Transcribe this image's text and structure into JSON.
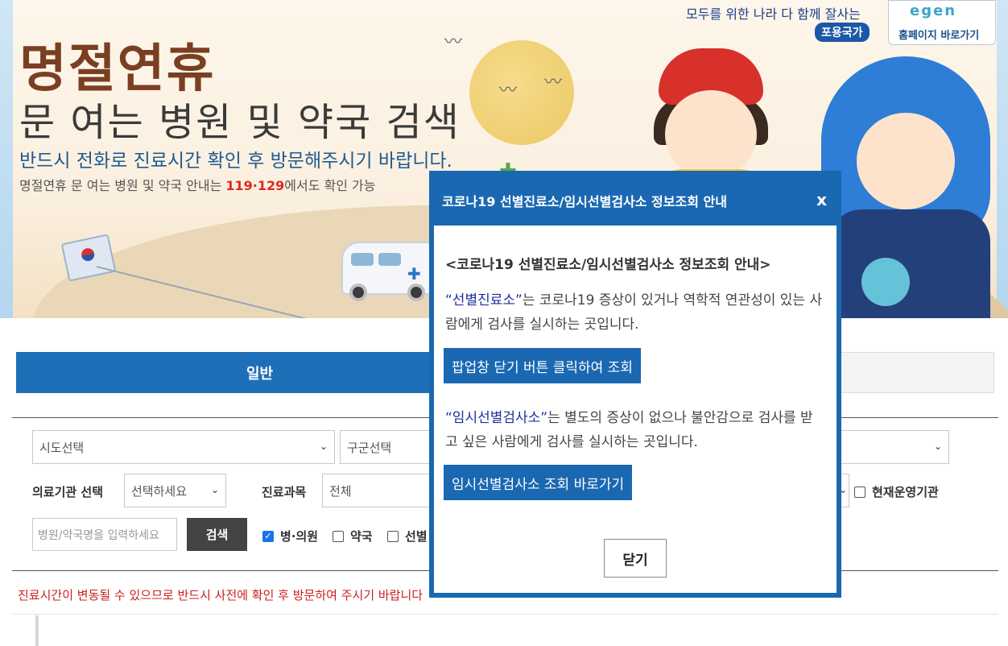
{
  "banner": {
    "title_main": "명절연휴",
    "title_sub": "문 여는 병원 및 약국 검색",
    "notice": "반드시 전화로 진료시간 확인 후 방문해주시기 바랍니다.",
    "desc_pre": "명절연휴 문 여는 병원 및 약국 안내는 ",
    "desc_hot": "119·129",
    "desc_post": "에서도 확인 가능",
    "slogan": "모두를 위한 나라 다 함께 잘사는",
    "slogan_badge": "포용국가",
    "home_logo": "egen",
    "home_label": "홈페이지 바로가기"
  },
  "tabs": [
    {
      "label": "일반",
      "active": true
    },
    {
      "label": "",
      "active": false
    }
  ],
  "form": {
    "sido": "시도선택",
    "gugun": "구군선택",
    "institution_label": "의료기관 선택",
    "institution_value": "선택하세요",
    "department_label": "진료과목",
    "department_value": "전체",
    "open_now": "현재운영기관",
    "search_placeholder": "병원/약국명을 입력하세요",
    "search_button": "검색",
    "checks": [
      {
        "label": "병·의원",
        "checked": true
      },
      {
        "label": "약국",
        "checked": false
      },
      {
        "label": "선별",
        "checked": false
      }
    ]
  },
  "warning": "진료시간이 변동될 수 있으므로 반드시 사전에 확인 후 방문하여 주시기 바랍니다",
  "modal": {
    "title": "코로나19 선별진료소/임시선별검사소 정보조회 안내",
    "close_x": "x",
    "heading": "<코로나19 선별진료소/임시선별검사소 정보조회 안내>",
    "para1_quote": "“선별진료소”",
    "para1_text": "는 코로나19 증상이 있거나 역학적 연관성이 있는 사람에게 검사를 실시하는 곳입니다.",
    "btn1": "팝업창 닫기 버튼 클릭하여 조회",
    "para2_quote": "“임시선별검사소”",
    "para2_text": "는 별도의 증상이 없으나 불안감으로 검사를 받고 싶은 사람에게 검사를 실시하는 곳입니다.",
    "btn2": "임시선별검사소 조회 바로가기",
    "close_button": "닫기"
  },
  "colors": {
    "primary": "#1b68b2",
    "warning": "#c8211f",
    "hotline": "#e0281c"
  }
}
